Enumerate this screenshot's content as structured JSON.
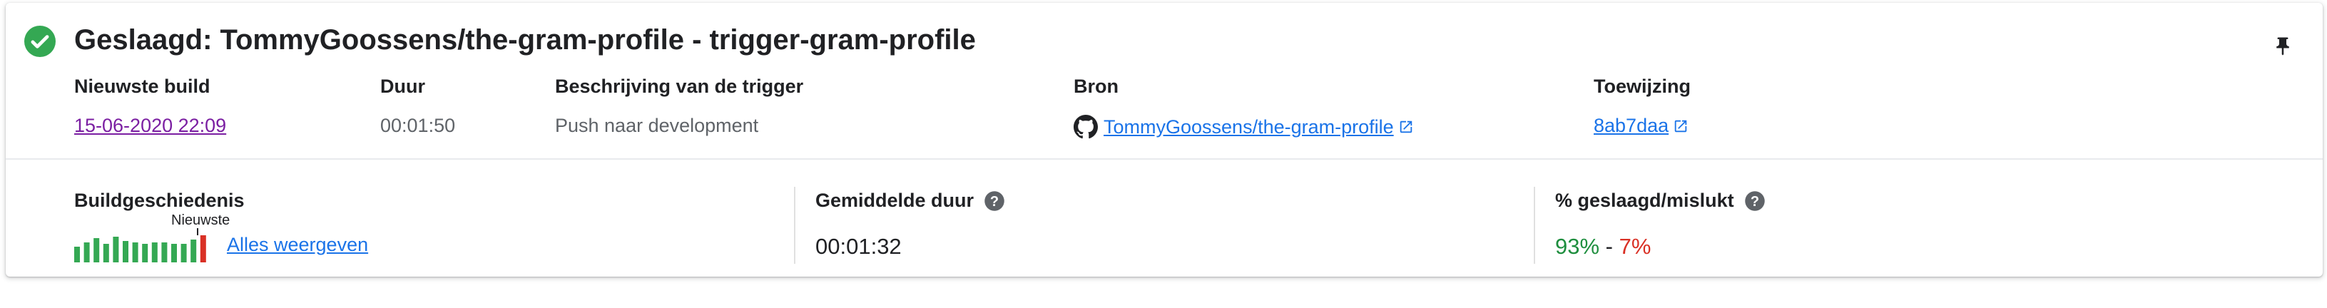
{
  "colors": {
    "success": "#34a853",
    "failure": "#d93025",
    "link": "#1a73e8",
    "visited_link": "#7b1fa2"
  },
  "header": {
    "status_icon": "check-circle-icon",
    "title": "Geslaagd: TommyGoossens/the-gram-profile - trigger-gram-profile",
    "pin_icon": "pin-icon"
  },
  "fields": {
    "newest_build": {
      "label": "Nieuwste build",
      "value": "15-06-2020 22:09"
    },
    "duration": {
      "label": "Duur",
      "value": "00:01:50"
    },
    "trigger_description": {
      "label": "Beschrijving van de trigger",
      "value": "Push naar development"
    },
    "source": {
      "label": "Bron",
      "value": "TommyGoossens/the-gram-profile",
      "icon": "github-icon"
    },
    "commit": {
      "label": "Toewijzing",
      "value": "8ab7daa"
    }
  },
  "build_history": {
    "label": "Buildgeschiedenis",
    "newest_label": "Nieuwste",
    "show_all": "Alles weergeven",
    "bars": [
      "success",
      "success",
      "success",
      "success",
      "success",
      "success",
      "success",
      "success",
      "success",
      "success",
      "success",
      "success",
      "success",
      "failure"
    ]
  },
  "average_duration": {
    "label": "Gemiddelde duur",
    "value": "00:01:32"
  },
  "pass_fail": {
    "label": "% geslaagd/mislukt",
    "success": "93%",
    "separator": " - ",
    "failure": "7%"
  }
}
